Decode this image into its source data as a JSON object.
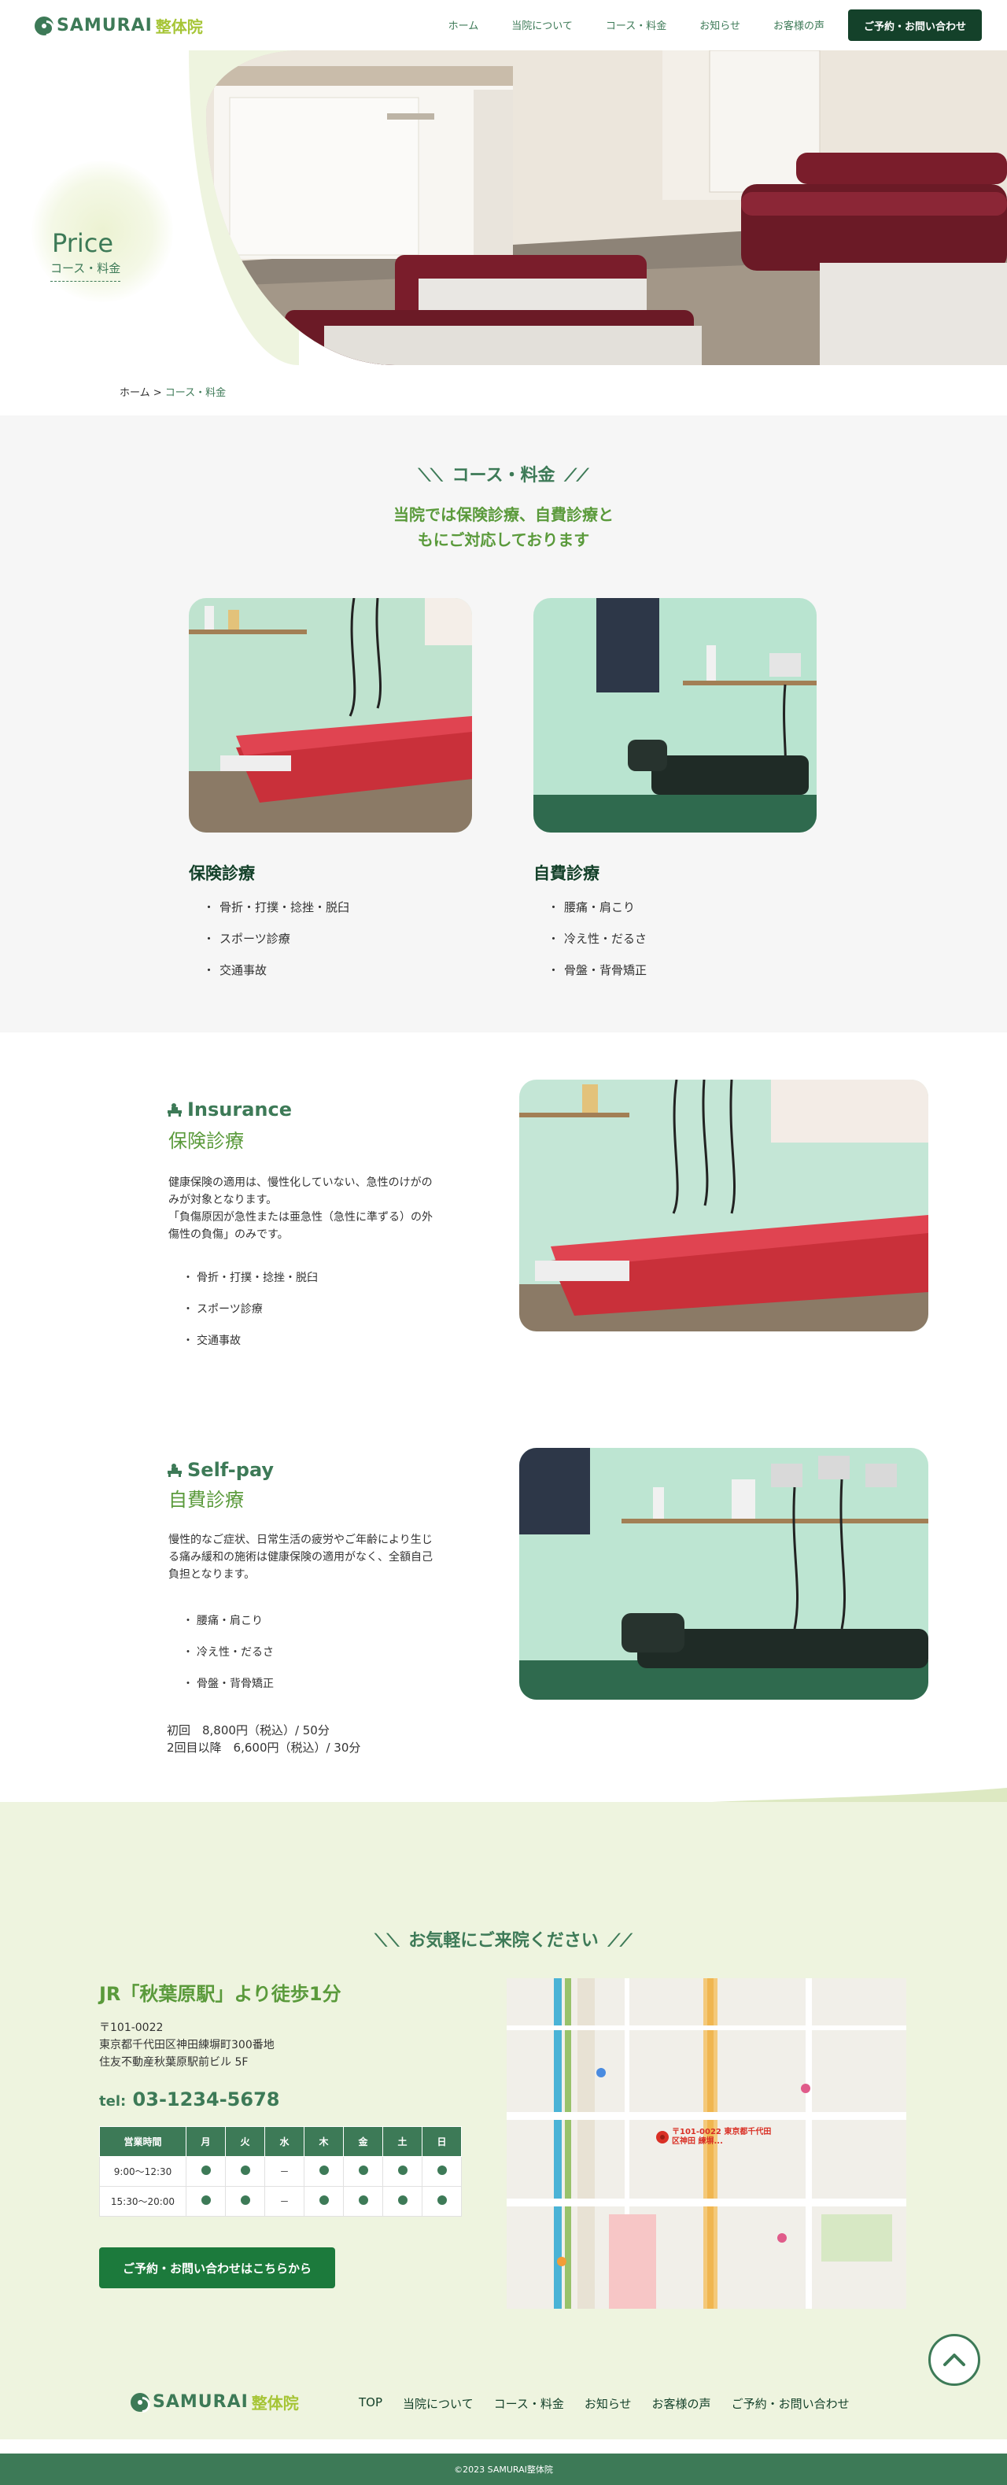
{
  "header": {
    "logo_text": "SAMURAI",
    "logo_sub": "整体院",
    "nav": [
      "ホーム",
      "当院について",
      "コース・料金",
      "お知らせ",
      "お客様の声"
    ],
    "cta": "ご予約・お問い合わせ"
  },
  "hero": {
    "title": "Price",
    "subtitle": "コース・料金"
  },
  "breadcrumb": {
    "home": "ホーム",
    "sep": " > ",
    "current": "コース・料金"
  },
  "overview": {
    "title": "コース・料金",
    "lead_line1": "当院では保険診療、自費診療と",
    "lead_line2": "もにご対応しております",
    "cards": [
      {
        "title": "保険診療",
        "items": [
          "骨折・打撲・捻挫・脱臼",
          "スポーツ診療",
          "交通事故"
        ]
      },
      {
        "title": "自費診療",
        "items": [
          "腰痛・肩こり",
          "冷え性・だるさ",
          "骨盤・背骨矯正"
        ]
      }
    ]
  },
  "insurance": {
    "label": "Insurance",
    "sub": "保険診療",
    "text_l1": "健康保険の適用は、慢性化していない、急性のけがの",
    "text_l2": "みが対象となります。",
    "text_l3": "「負傷原因が急性または亜急性（急性に準ずる）の外",
    "text_l4": "傷性の負傷」のみです。",
    "items": [
      "骨折・打撲・捻挫・脱臼",
      "スポーツ診療",
      "交通事故"
    ]
  },
  "selfpay": {
    "label": "Self-pay",
    "sub": "自費診療",
    "text_l1": "慢性的なご症状、日常生活の疲労やご年齢により生じ",
    "text_l2": "る痛み緩和の施術は健康保険の適用がなく、全額自己",
    "text_l3": "負担となります。",
    "items": [
      "腰痛・肩こり",
      "冷え性・だるさ",
      "骨盤・背骨矯正"
    ],
    "price1": "初回　8,800円（税込）/ 50分",
    "price2": "2回目以降　6,600円（税込）/ 30分"
  },
  "access": {
    "title": "お気軽にご来院ください",
    "head": "JR「秋葉原駅」より徒歩1分",
    "zip": "〒101-0022",
    "addr1": "東京都千代田区神田練塀町300番地",
    "addr2": "住友不動産秋葉原駅前ビル 5F",
    "tel_prefix": "tel:",
    "tel": "03-1234-5678",
    "hours": {
      "header": [
        "営業時間",
        "月",
        "火",
        "水",
        "木",
        "金",
        "土",
        "日"
      ],
      "rows": [
        {
          "time": "9:00〜12:30",
          "cells": [
            "●",
            "●",
            "－",
            "●",
            "●",
            "●",
            "●"
          ]
        },
        {
          "time": "15:30〜20:00",
          "cells": [
            "●",
            "●",
            "－",
            "●",
            "●",
            "●",
            "●"
          ]
        }
      ]
    },
    "cta": "ご予約・お問い合わせはこちらから",
    "map_pin_label": "〒101-0022 東京都千代田区神田 練塀..."
  },
  "footer": {
    "logo_text": "SAMURAI",
    "logo_sub": "整体院",
    "nav": [
      "TOP",
      "当院について",
      "コース・料金",
      "お知らせ",
      "お客様の声",
      "ご予約・お問い合わせ"
    ],
    "copyright": "©2023 SAMURAI整体院"
  }
}
